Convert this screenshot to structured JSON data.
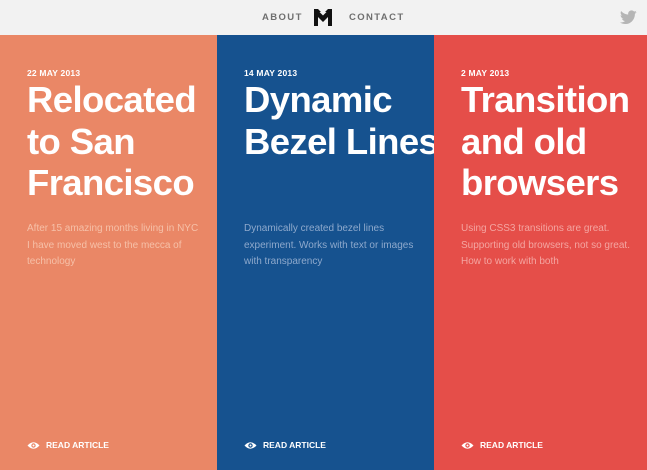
{
  "nav": {
    "about": "ABOUT",
    "contact": "CONTACT",
    "logo_icon": "m-logo-icon",
    "twitter_icon": "twitter-bird-icon"
  },
  "colors": {
    "topbar": "#f2f2f2",
    "nav_text": "#6f6f6f",
    "twitter": "#b5b5b5"
  },
  "posts": [
    {
      "date": "22 MAY 2013",
      "title": "Relocated to San Francisco",
      "excerpt": "After 15 amazing months living in NYC I have moved west to the mecca of technology",
      "link_label": "READ ARTICLE",
      "bg": "#ea8766",
      "excerpt_color": "#f6c0a8"
    },
    {
      "date": "14 MAY 2013",
      "title": "Dynamic Bezel Lines",
      "excerpt": "Dynamically created bezel lines experiment. Works with text or images with transparency",
      "link_label": "READ ARTICLE",
      "bg": "#16528f",
      "excerpt_color": "#8ea9cc"
    },
    {
      "date": "2 MAY 2013",
      "title": "Transition and old browsers",
      "excerpt": "Using CSS3 transitions are great. Supporting old browsers, not so great. How to work with both",
      "link_label": "READ ARTICLE",
      "bg": "#e54e49",
      "excerpt_color": "#f4a5a1"
    }
  ]
}
